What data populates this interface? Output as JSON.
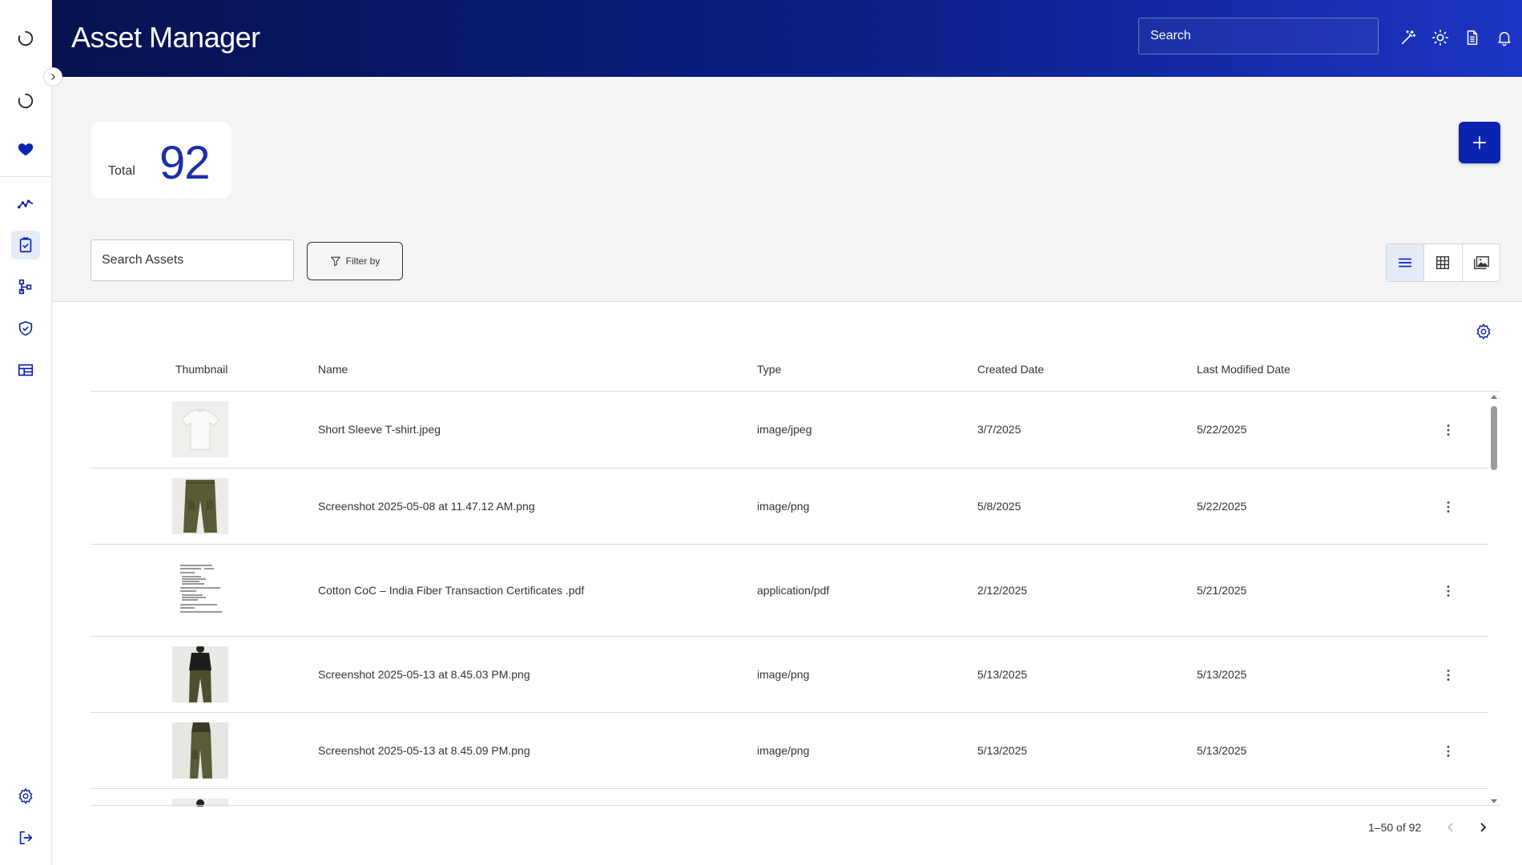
{
  "app": {
    "title": "Asset Manager",
    "brand_color": "#0a23b0",
    "header_gradient": [
      "#07124f",
      "#1c35c4"
    ]
  },
  "header": {
    "search_placeholder": "Search",
    "icons": [
      "magic-wand-icon",
      "sun-icon",
      "document-icon",
      "bell-icon"
    ]
  },
  "sidebar": {
    "top_icons": [
      "loading-spinner-icon",
      "loading-spinner-icon",
      "heart-icon"
    ],
    "nav_icons": [
      "trend-chart-icon",
      "clipboard-check-icon",
      "hierarchy-icon",
      "shield-check-icon",
      "dashboard-layout-icon"
    ],
    "active_item": "clipboard-check-icon",
    "bottom_icons": [
      "gear-icon",
      "logout-icon"
    ]
  },
  "summary": {
    "total_label": "Total",
    "total_value": "92"
  },
  "toolbar": {
    "search_placeholder": "Search Assets",
    "filter_label": "Filter by",
    "view_modes": [
      "list-view-icon",
      "grid-view-icon",
      "gallery-view-icon"
    ],
    "active_view": "list-view-icon"
  },
  "table": {
    "columns": [
      "Thumbnail",
      "Name",
      "Type",
      "Created Date",
      "Last Modified Date"
    ],
    "rows": [
      {
        "name": "Short Sleeve T-shirt.jpeg",
        "type": "image/jpeg",
        "created": "3/7/2025",
        "modified": "5/22/2025",
        "thumb": "white-tshirt"
      },
      {
        "name": "Screenshot 2025-05-08 at 11.47.12 AM.png",
        "type": "image/png",
        "created": "5/8/2025",
        "modified": "5/22/2025",
        "thumb": "olive-pants"
      },
      {
        "name": "Cotton CoC – India Fiber Transaction Certificates .pdf",
        "type": "application/pdf",
        "created": "2/12/2025",
        "modified": "5/21/2025",
        "thumb": "pdf-document"
      },
      {
        "name": "Screenshot 2025-05-13 at 8.45.03 PM.png",
        "type": "image/png",
        "created": "5/13/2025",
        "modified": "5/13/2025",
        "thumb": "model-olive-pants"
      },
      {
        "name": "Screenshot 2025-05-13 at 8.45.09 PM.png",
        "type": "image/png",
        "created": "5/13/2025",
        "modified": "5/13/2025",
        "thumb": "olive-pants-side"
      }
    ]
  },
  "pagination": {
    "range_text": "1–50 of 92"
  }
}
